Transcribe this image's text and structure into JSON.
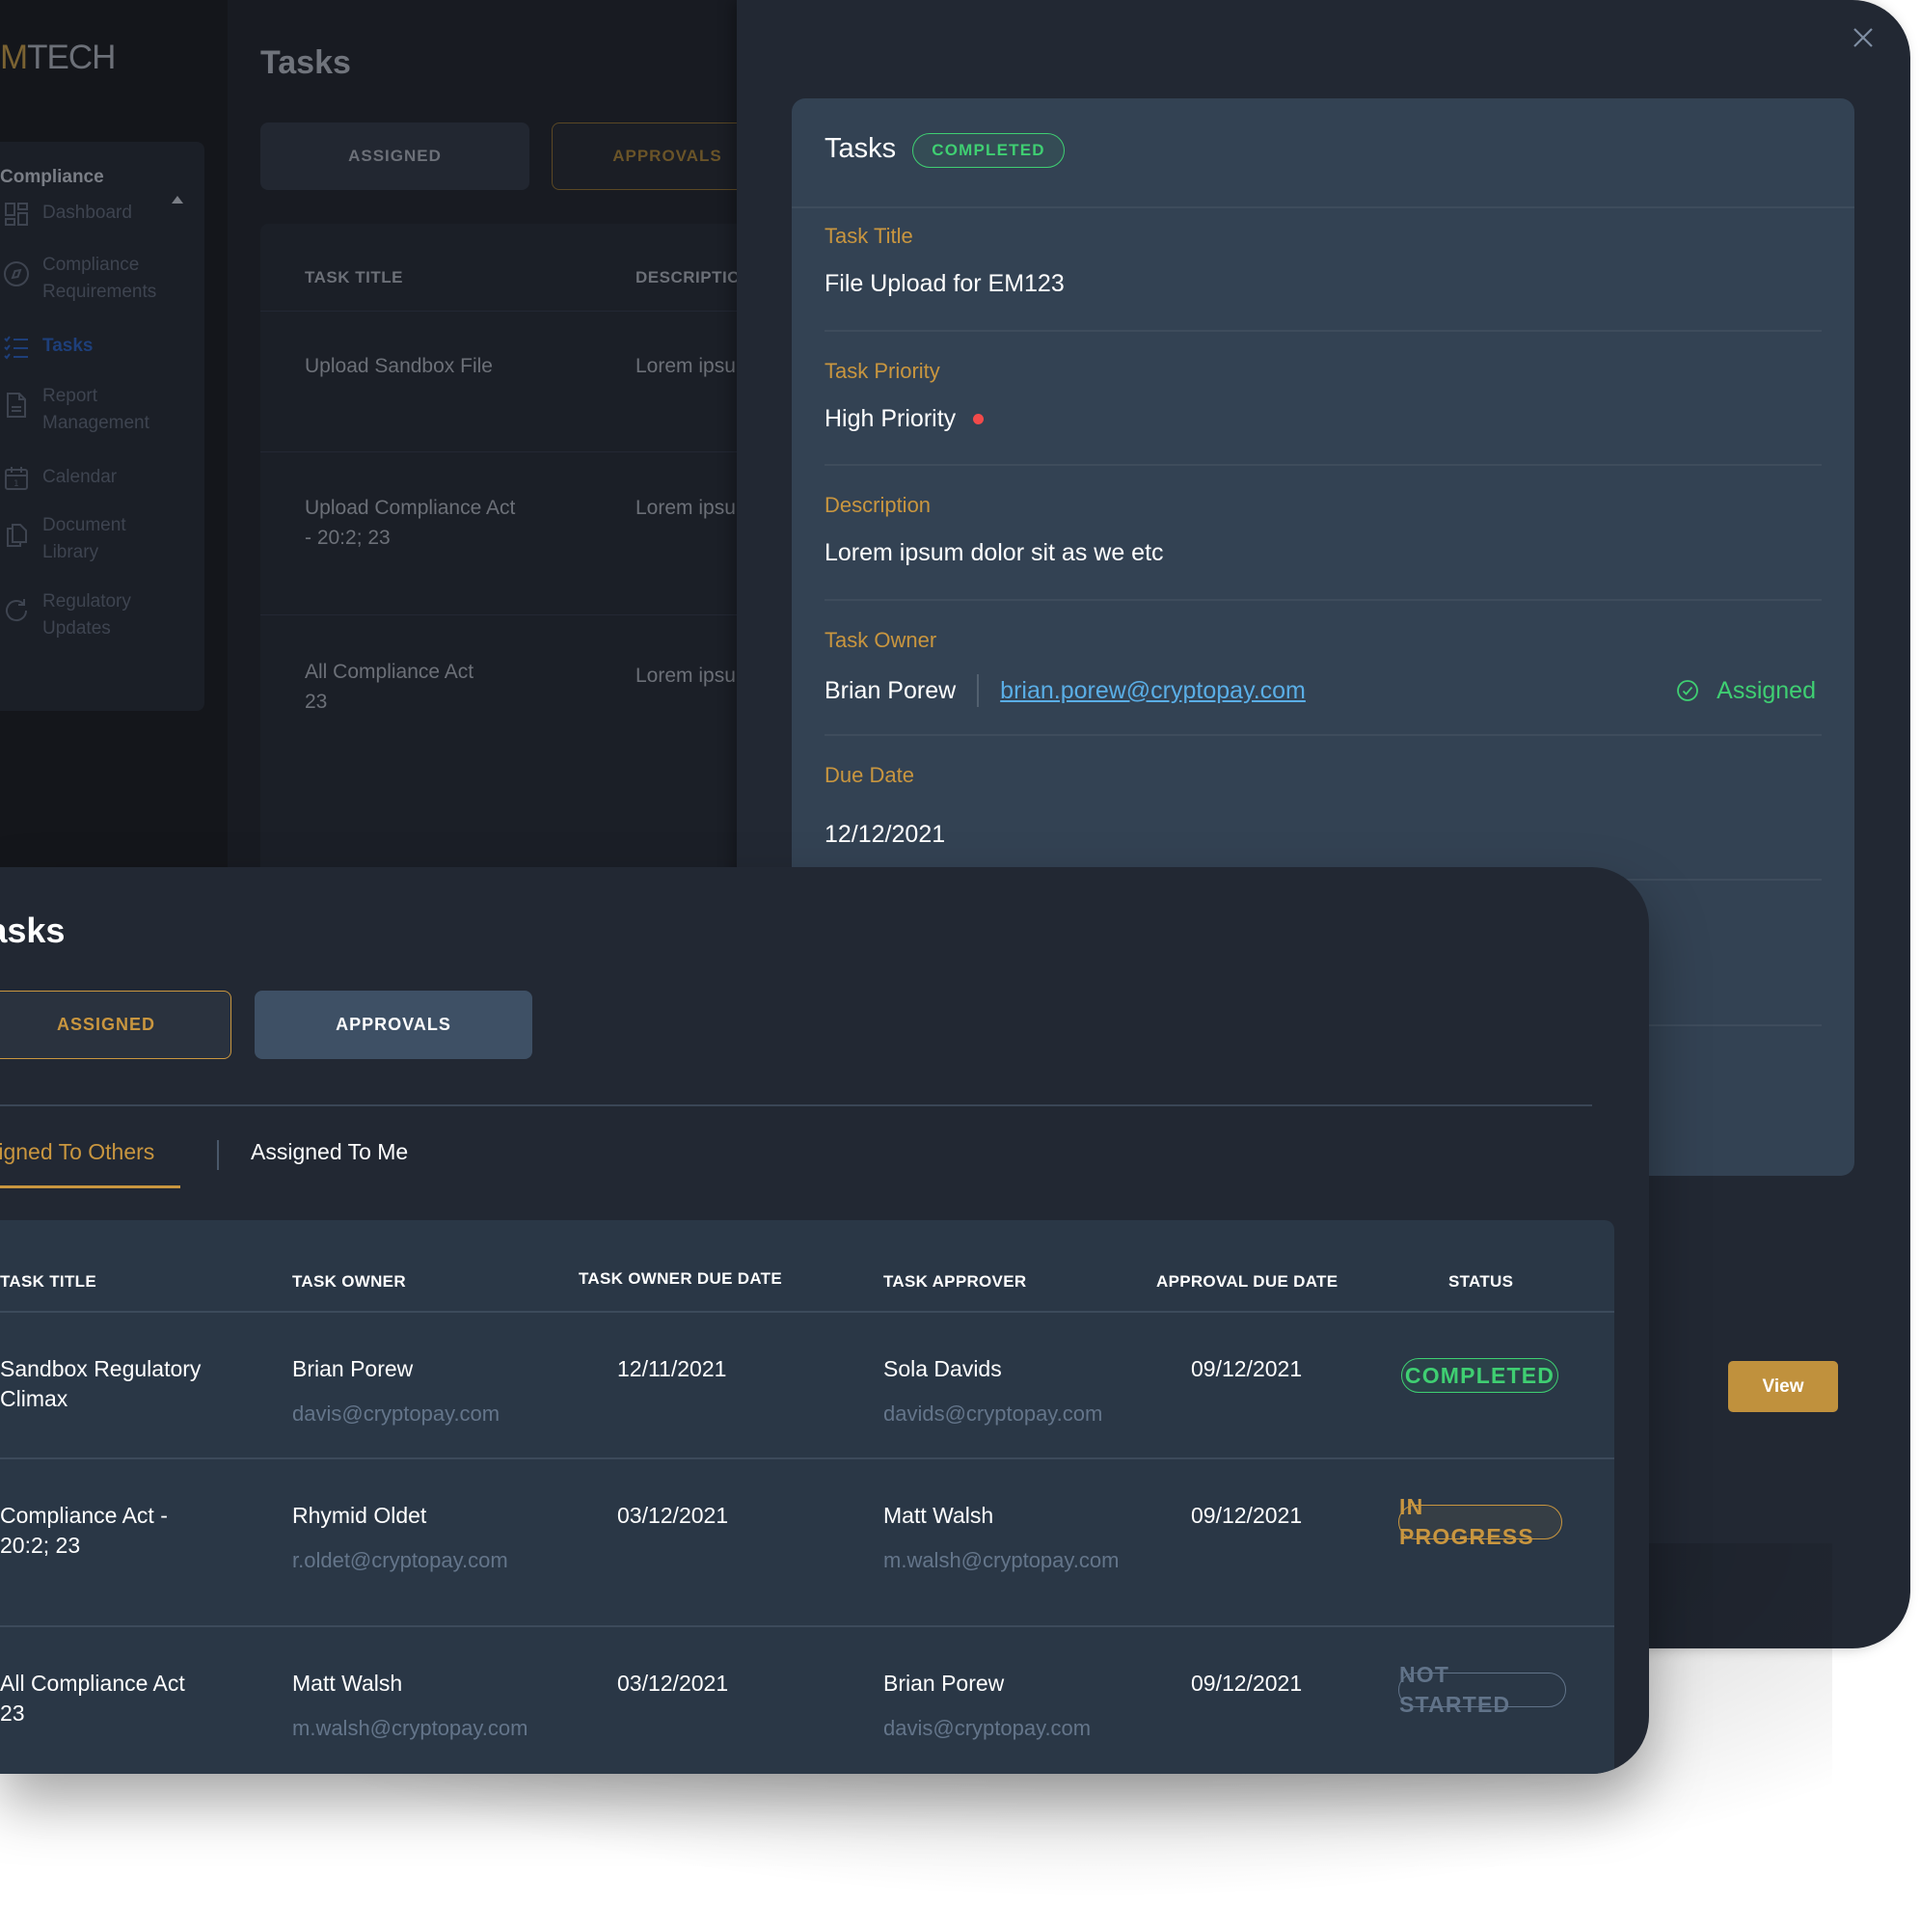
{
  "background_app": {
    "logo": {
      "accent": "M",
      "rest": "TECH"
    },
    "sidebar": {
      "group_label": "Compliance",
      "items": [
        {
          "label": "Dashboard",
          "icon": "dashboard-grid-icon",
          "active": false
        },
        {
          "label": "Compliance Requirements",
          "icon": "compass-icon",
          "active": false
        },
        {
          "label": "Tasks",
          "icon": "checklist-icon",
          "active": true
        },
        {
          "label": "Report Management",
          "icon": "document-icon",
          "active": false
        },
        {
          "label": "Calendar",
          "icon": "calendar-icon",
          "active": false
        },
        {
          "label": "Document Library",
          "icon": "copy-documents-icon",
          "active": false
        },
        {
          "label": "Regulatory Updates",
          "icon": "refresh-icon",
          "active": false
        }
      ]
    },
    "page_title": "Tasks",
    "buttons": {
      "assigned": "ASSIGNED",
      "approvals": "APPROVALS"
    },
    "table": {
      "headers": [
        "TASK TITLE",
        "DESCRIPTION"
      ],
      "rows": [
        {
          "title": "Upload Sandbox File",
          "description": "Lorem ipsum"
        },
        {
          "title": "Upload Compliance Act - 20:2; 23",
          "description": "Lorem ipsum"
        },
        {
          "title": "All Compliance Act 23",
          "description": "Lorem ipsum"
        }
      ]
    }
  },
  "detail_modal": {
    "close_icon": "close-icon",
    "title": "Tasks",
    "status": "COMPLETED",
    "fields": {
      "task_title": {
        "label": "Task Title",
        "value": "File Upload for EM123"
      },
      "task_priority": {
        "label": "Task Priority",
        "value": "High Priority",
        "indicator_color": "#f24a4a"
      },
      "description": {
        "label": "Description",
        "value": "Lorem ipsum dolor sit as we etc"
      },
      "task_owner": {
        "label": "Task Owner",
        "name": "Brian Porew",
        "email": "brian.porew@cryptopay.com",
        "status": "Assigned"
      },
      "due_date": {
        "label": "Due Date",
        "value": "12/12/2021"
      }
    },
    "view_button": "View"
  },
  "front_panel": {
    "title": "Tasks",
    "buttons": {
      "assigned": "ASSIGNED",
      "approvals": "APPROVALS"
    },
    "subtabs": {
      "others": "Assigned To Others",
      "me": "Assigned To Me",
      "active": "others"
    },
    "table": {
      "headers": [
        "TASK TITLE",
        "TASK OWNER",
        "TASK OWNER DUE DATE",
        "TASK APPROVER",
        "APPROVAL DUE DATE",
        "STATUS"
      ],
      "rows": [
        {
          "title": "Sandbox Regulatory Climax",
          "owner": "Brian Porew",
          "owner_email": "davis@cryptopay.com",
          "owner_due": "12/11/2021",
          "approver": "Sola Davids",
          "approver_email": "davids@cryptopay.com",
          "approval_due": "09/12/2021",
          "status": "COMPLETED",
          "status_kind": "completed"
        },
        {
          "title": "Compliance Act - 20:2; 23",
          "owner": "Rhymid Oldet",
          "owner_email": "r.oldet@cryptopay.com",
          "owner_due": "03/12/2021",
          "approver": "Matt Walsh",
          "approver_email": "m.walsh@cryptopay.com",
          "approval_due": "09/12/2021",
          "status": "IN PROGRESS",
          "status_kind": "inprogress"
        },
        {
          "title": "All Compliance Act 23",
          "owner": "Matt Walsh",
          "owner_email": "m.walsh@cryptopay.com",
          "owner_due": "03/12/2021",
          "approver": "Brian Porew",
          "approver_email": "davis@cryptopay.com",
          "approval_due": "09/12/2021",
          "status": "NOT STARTED",
          "status_kind": "notstarted"
        }
      ]
    }
  },
  "colors": {
    "accent_gold": "#c9963f",
    "success_green": "#3fcf72",
    "link_blue": "#5aaee6",
    "panel_bg": "#222833",
    "card_bg": "#334253"
  }
}
